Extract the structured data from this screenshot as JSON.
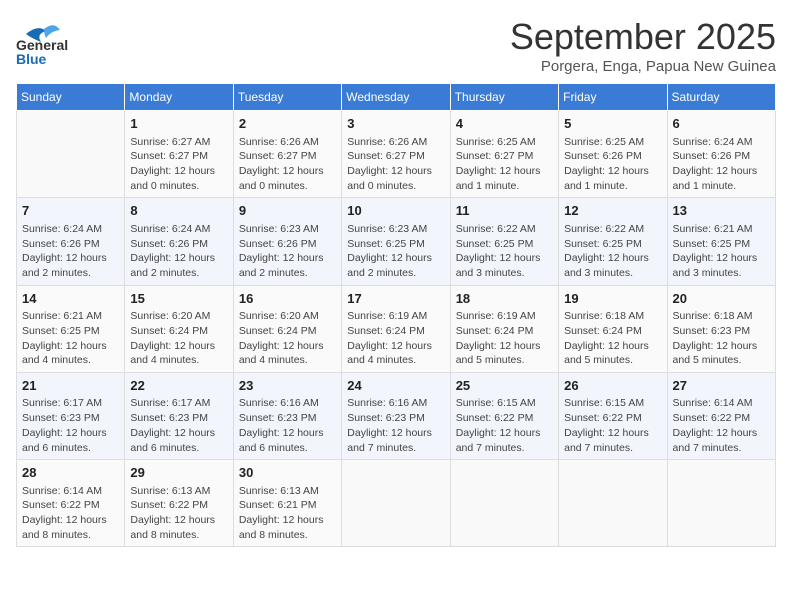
{
  "header": {
    "logo_line1": "General",
    "logo_line2": "Blue",
    "month": "September 2025",
    "location": "Porgera, Enga, Papua New Guinea"
  },
  "days_of_week": [
    "Sunday",
    "Monday",
    "Tuesday",
    "Wednesday",
    "Thursday",
    "Friday",
    "Saturday"
  ],
  "weeks": [
    [
      {
        "day": "",
        "info": ""
      },
      {
        "day": "1",
        "info": "Sunrise: 6:27 AM\nSunset: 6:27 PM\nDaylight: 12 hours\nand 0 minutes."
      },
      {
        "day": "2",
        "info": "Sunrise: 6:26 AM\nSunset: 6:27 PM\nDaylight: 12 hours\nand 0 minutes."
      },
      {
        "day": "3",
        "info": "Sunrise: 6:26 AM\nSunset: 6:27 PM\nDaylight: 12 hours\nand 0 minutes."
      },
      {
        "day": "4",
        "info": "Sunrise: 6:25 AM\nSunset: 6:27 PM\nDaylight: 12 hours\nand 1 minute."
      },
      {
        "day": "5",
        "info": "Sunrise: 6:25 AM\nSunset: 6:26 PM\nDaylight: 12 hours\nand 1 minute."
      },
      {
        "day": "6",
        "info": "Sunrise: 6:24 AM\nSunset: 6:26 PM\nDaylight: 12 hours\nand 1 minute."
      }
    ],
    [
      {
        "day": "7",
        "info": "Sunrise: 6:24 AM\nSunset: 6:26 PM\nDaylight: 12 hours\nand 2 minutes."
      },
      {
        "day": "8",
        "info": "Sunrise: 6:24 AM\nSunset: 6:26 PM\nDaylight: 12 hours\nand 2 minutes."
      },
      {
        "day": "9",
        "info": "Sunrise: 6:23 AM\nSunset: 6:26 PM\nDaylight: 12 hours\nand 2 minutes."
      },
      {
        "day": "10",
        "info": "Sunrise: 6:23 AM\nSunset: 6:25 PM\nDaylight: 12 hours\nand 2 minutes."
      },
      {
        "day": "11",
        "info": "Sunrise: 6:22 AM\nSunset: 6:25 PM\nDaylight: 12 hours\nand 3 minutes."
      },
      {
        "day": "12",
        "info": "Sunrise: 6:22 AM\nSunset: 6:25 PM\nDaylight: 12 hours\nand 3 minutes."
      },
      {
        "day": "13",
        "info": "Sunrise: 6:21 AM\nSunset: 6:25 PM\nDaylight: 12 hours\nand 3 minutes."
      }
    ],
    [
      {
        "day": "14",
        "info": "Sunrise: 6:21 AM\nSunset: 6:25 PM\nDaylight: 12 hours\nand 4 minutes."
      },
      {
        "day": "15",
        "info": "Sunrise: 6:20 AM\nSunset: 6:24 PM\nDaylight: 12 hours\nand 4 minutes."
      },
      {
        "day": "16",
        "info": "Sunrise: 6:20 AM\nSunset: 6:24 PM\nDaylight: 12 hours\nand 4 minutes."
      },
      {
        "day": "17",
        "info": "Sunrise: 6:19 AM\nSunset: 6:24 PM\nDaylight: 12 hours\nand 4 minutes."
      },
      {
        "day": "18",
        "info": "Sunrise: 6:19 AM\nSunset: 6:24 PM\nDaylight: 12 hours\nand 5 minutes."
      },
      {
        "day": "19",
        "info": "Sunrise: 6:18 AM\nSunset: 6:24 PM\nDaylight: 12 hours\nand 5 minutes."
      },
      {
        "day": "20",
        "info": "Sunrise: 6:18 AM\nSunset: 6:23 PM\nDaylight: 12 hours\nand 5 minutes."
      }
    ],
    [
      {
        "day": "21",
        "info": "Sunrise: 6:17 AM\nSunset: 6:23 PM\nDaylight: 12 hours\nand 6 minutes."
      },
      {
        "day": "22",
        "info": "Sunrise: 6:17 AM\nSunset: 6:23 PM\nDaylight: 12 hours\nand 6 minutes."
      },
      {
        "day": "23",
        "info": "Sunrise: 6:16 AM\nSunset: 6:23 PM\nDaylight: 12 hours\nand 6 minutes."
      },
      {
        "day": "24",
        "info": "Sunrise: 6:16 AM\nSunset: 6:23 PM\nDaylight: 12 hours\nand 7 minutes."
      },
      {
        "day": "25",
        "info": "Sunrise: 6:15 AM\nSunset: 6:22 PM\nDaylight: 12 hours\nand 7 minutes."
      },
      {
        "day": "26",
        "info": "Sunrise: 6:15 AM\nSunset: 6:22 PM\nDaylight: 12 hours\nand 7 minutes."
      },
      {
        "day": "27",
        "info": "Sunrise: 6:14 AM\nSunset: 6:22 PM\nDaylight: 12 hours\nand 7 minutes."
      }
    ],
    [
      {
        "day": "28",
        "info": "Sunrise: 6:14 AM\nSunset: 6:22 PM\nDaylight: 12 hours\nand 8 minutes."
      },
      {
        "day": "29",
        "info": "Sunrise: 6:13 AM\nSunset: 6:22 PM\nDaylight: 12 hours\nand 8 minutes."
      },
      {
        "day": "30",
        "info": "Sunrise: 6:13 AM\nSunset: 6:21 PM\nDaylight: 12 hours\nand 8 minutes."
      },
      {
        "day": "",
        "info": ""
      },
      {
        "day": "",
        "info": ""
      },
      {
        "day": "",
        "info": ""
      },
      {
        "day": "",
        "info": ""
      }
    ]
  ]
}
